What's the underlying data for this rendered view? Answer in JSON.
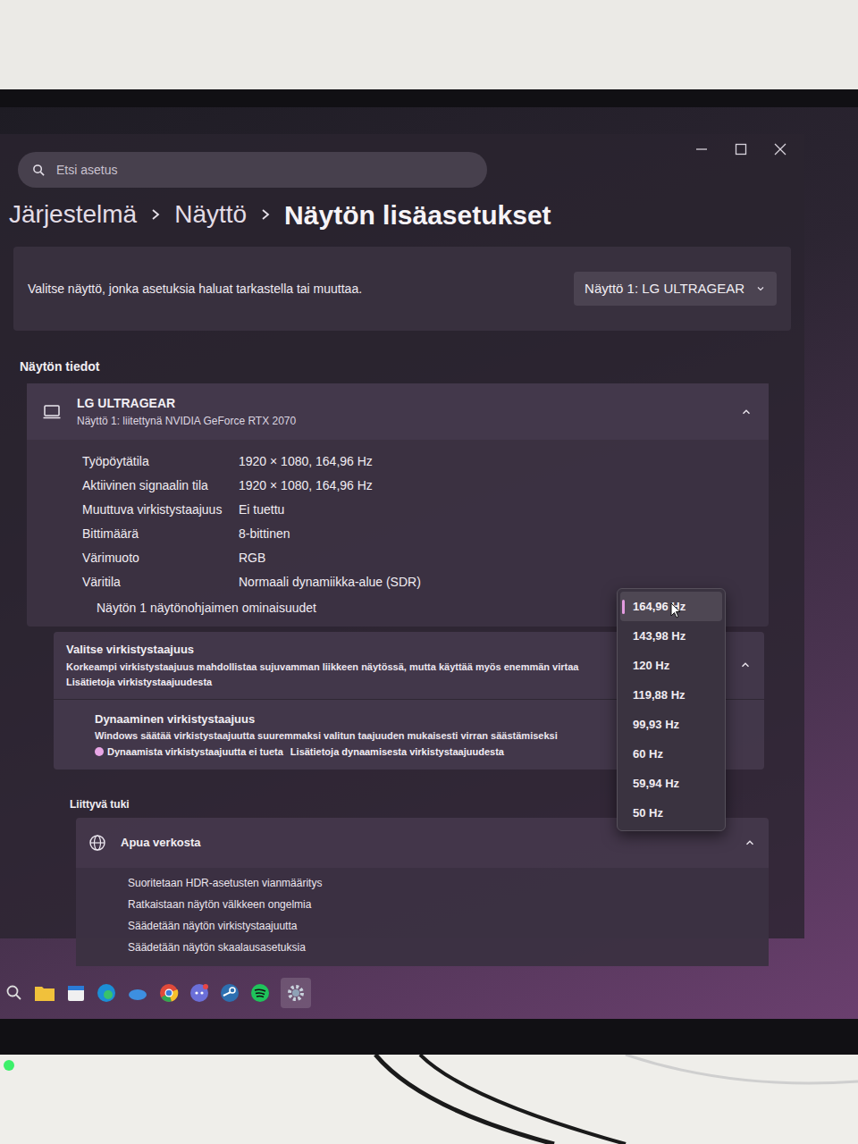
{
  "search": {
    "placeholder": "Etsi asetus"
  },
  "breadcrumb": [
    "Järjestelmä",
    "Näyttö",
    "Näytön lisäasetukset"
  ],
  "display_picker": {
    "label": "Valitse näyttö, jonka asetuksia haluat tarkastella tai muuttaa.",
    "value": "Näyttö 1: LG ULTRAGEAR"
  },
  "display_info": {
    "heading": "Näytön tiedot",
    "name": "LG ULTRAGEAR",
    "subtitle": "Näyttö 1: liitettynä NVIDIA GeForce RTX 2070",
    "expanded": true,
    "rows": [
      {
        "label": "Työpöytätila",
        "value": "1920 × 1080, 164,96 Hz"
      },
      {
        "label": "Aktiivinen signaalin tila",
        "value": "1920 × 1080, 164,96 Hz"
      },
      {
        "label": "Muuttuva virkistystaajuus",
        "value": "Ei tuettu"
      },
      {
        "label": "Bittimäärä",
        "value": "8-bittinen"
      },
      {
        "label": "Värimuoto",
        "value": "RGB"
      },
      {
        "label": "Väritila",
        "value": "Normaali dynamiikka-alue (SDR)"
      }
    ],
    "link": "Näytön 1 näytönohjaimen ominaisuudet"
  },
  "refresh_rate": {
    "title": "Valitse virkistystaajuus",
    "description": "Korkeampi virkistystaajuus mahdollistaa sujuvamman liikkeen näytössä, mutta käyttää myös enemmän virtaa",
    "link": "Lisätietoja virkistystaajuudesta",
    "expanded": true,
    "options": [
      {
        "label": "164,96 Hz",
        "selected": true
      },
      {
        "label": "143,98 Hz",
        "selected": false
      },
      {
        "label": "120 Hz",
        "selected": false
      },
      {
        "label": "119,88 Hz",
        "selected": false
      },
      {
        "label": "99,93 Hz",
        "selected": false
      },
      {
        "label": "60 Hz",
        "selected": false
      },
      {
        "label": "59,94 Hz",
        "selected": false
      },
      {
        "label": "50 Hz",
        "selected": false
      }
    ]
  },
  "dynamic_refresh": {
    "title": "Dynaaminen virkistystaajuus",
    "description": "Windows säätää virkistystaajuutta suuremmaksi valitun taajuuden mukaisesti virran säästämiseksi",
    "warning": "Dynaamista virkistystaajuutta ei tueta",
    "link": "Lisätietoja dynaamisesta virkistystaajuudesta"
  },
  "related_support": {
    "heading": "Liittyvä tuki",
    "card": {
      "title": "Apua verkosta",
      "expanded": true,
      "links": [
        "Suoritetaan HDR-asetusten vianmääritys",
        "Ratkaistaan näytön välkkeen ongelmia",
        "Säädetään näytön virkistystaajuutta",
        "Säädetään näytön skaalausasetuksia"
      ]
    }
  }
}
